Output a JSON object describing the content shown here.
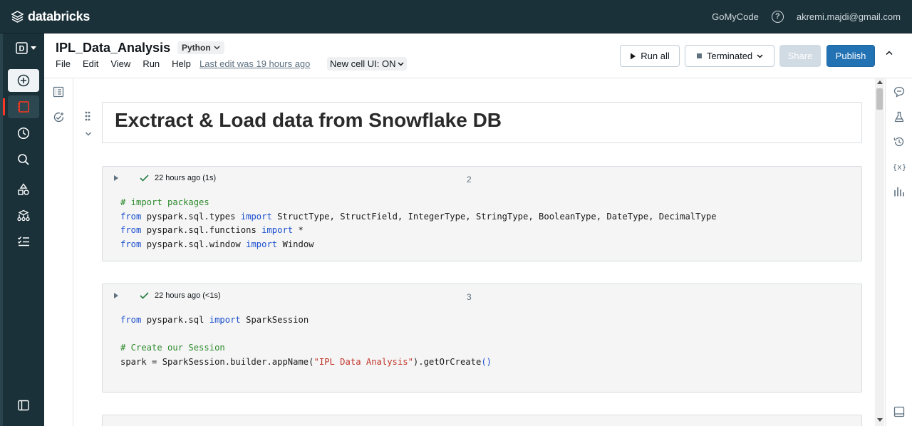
{
  "topbar": {
    "brand": "databricks",
    "workspace": "GoMyCode",
    "user": "akremi.majdi@gmail.com"
  },
  "leftnav": {
    "workspace_letter": "D",
    "items": [
      "new-icon",
      "workspace-icon",
      "recents-icon",
      "search-icon",
      "catalog-icon",
      "workflows-icon",
      "tasks-icon",
      "sidebar-toggle-icon"
    ]
  },
  "notebook": {
    "title": "IPL_Data_Analysis",
    "language": "Python",
    "menu": [
      "File",
      "Edit",
      "View",
      "Run",
      "Help"
    ],
    "last_edit": "Last edit was 19 hours ago",
    "new_cell_ui": "New cell UI: ON",
    "run_all": "Run all",
    "cluster_state": "Terminated",
    "share": "Share",
    "publish": "Publish"
  },
  "cells": {
    "heading": "Exctract & Load data from Snowflake DB",
    "cell2": {
      "status": "22 hours ago (1s)",
      "number": "2"
    },
    "cell3": {
      "status": "22 hours ago (<1s)",
      "number": "3"
    }
  },
  "colors": {
    "topbar": "#1b3139",
    "accent": "#2272b4",
    "active_marker": "#ff3621",
    "success": "#277c43"
  }
}
